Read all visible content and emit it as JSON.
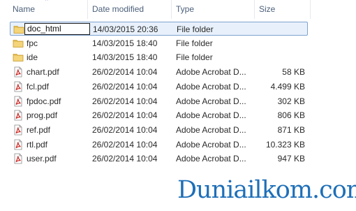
{
  "columns": {
    "name": "Name",
    "date": "Date modified",
    "type": "Type",
    "size": "Size"
  },
  "rows": [
    {
      "name": "doc_html",
      "date": "14/03/2015 20:36",
      "type": "File folder",
      "size": "",
      "icon": "folder-icon",
      "selected": true,
      "editing": true
    },
    {
      "name": "fpc",
      "date": "14/03/2015 18:40",
      "type": "File folder",
      "size": "",
      "icon": "folder-icon"
    },
    {
      "name": "ide",
      "date": "14/03/2015 18:40",
      "type": "File folder",
      "size": "",
      "icon": "folder-icon"
    },
    {
      "name": "chart.pdf",
      "date": "26/02/2014 10:04",
      "type": "Adobe Acrobat D...",
      "size": "58 KB",
      "icon": "pdf-icon"
    },
    {
      "name": "fcl.pdf",
      "date": "26/02/2014 10:04",
      "type": "Adobe Acrobat D...",
      "size": "4.499 KB",
      "icon": "pdf-icon"
    },
    {
      "name": "fpdoc.pdf",
      "date": "26/02/2014 10:04",
      "type": "Adobe Acrobat D...",
      "size": "302 KB",
      "icon": "pdf-icon"
    },
    {
      "name": "prog.pdf",
      "date": "26/02/2014 10:04",
      "type": "Adobe Acrobat D...",
      "size": "806 KB",
      "icon": "pdf-icon"
    },
    {
      "name": "ref.pdf",
      "date": "26/02/2014 10:04",
      "type": "Adobe Acrobat D...",
      "size": "871 KB",
      "icon": "pdf-icon"
    },
    {
      "name": "rtl.pdf",
      "date": "26/02/2014 10:04",
      "type": "Adobe Acrobat D...",
      "size": "10.323 KB",
      "icon": "pdf-icon"
    },
    {
      "name": "user.pdf",
      "date": "26/02/2014 10:04",
      "type": "Adobe Acrobat D...",
      "size": "947 KB",
      "icon": "pdf-icon"
    }
  ],
  "watermark": "Duniailkom.com",
  "colors": {
    "selection_bg": "#e8f1fb",
    "selection_border": "#7da2ce",
    "header_text": "#4c607a",
    "folder": "#e8c15a",
    "pdf_red": "#c8201c",
    "watermark": "#1e6fb8"
  }
}
